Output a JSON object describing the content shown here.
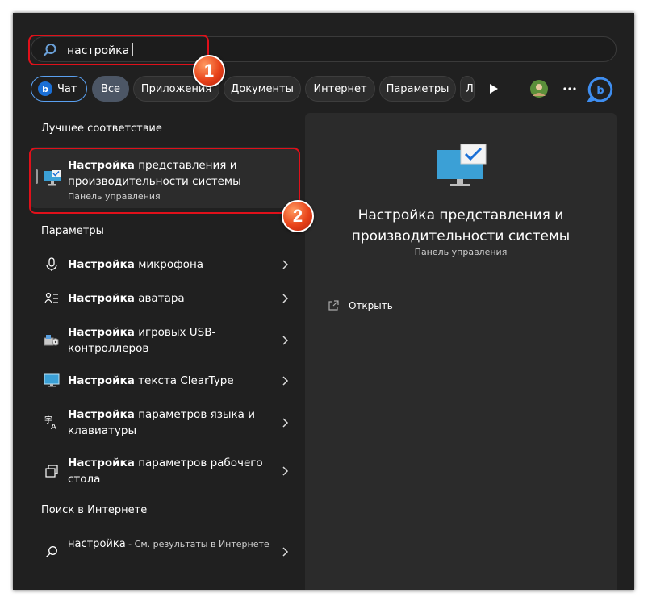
{
  "search": {
    "value": "настройка"
  },
  "badges": {
    "b1": "1",
    "b2": "2"
  },
  "chips": {
    "chat": "Чат",
    "all": "Все",
    "apps": "Приложения",
    "docs": "Документы",
    "internet": "Интернет",
    "settings": "Параметры",
    "overflow": "Л"
  },
  "best_match": {
    "heading": "Лучшее соответствие",
    "title_bold": "Настройка",
    "title_rest": " представления и производительности системы",
    "subtitle": "Панель управления"
  },
  "settings_section": {
    "heading": "Параметры",
    "items": [
      {
        "bold": "Настройка",
        "rest": " микрофона",
        "icon": "microphone-icon"
      },
      {
        "bold": "Настройка",
        "rest": " аватара",
        "icon": "avatar-icon"
      },
      {
        "bold": "Настройка",
        "rest": " игровых USB-контроллеров",
        "icon": "usb-controller-icon"
      },
      {
        "bold": "Настройка",
        "rest": " текста ClearType",
        "icon": "monitor-icon"
      },
      {
        "bold": "Настройка",
        "rest": " параметров языка и клавиатуры",
        "icon": "language-icon"
      },
      {
        "bold": "Настройка",
        "rest": " параметров рабочего стола",
        "icon": "desktop-icon"
      }
    ]
  },
  "web_section": {
    "heading": "Поиск в Интернете",
    "item_query": "настройка",
    "item_rest": " - См. результаты в Интернете"
  },
  "preview": {
    "title": "Настройка представления и производительности системы",
    "subtitle": "Панель управления",
    "open_label": "Открыть"
  },
  "colors": {
    "panel": "#202020",
    "highlight": "#e0101a",
    "accent_blue": "#1a6fd6",
    "badge": "#e8431a"
  }
}
